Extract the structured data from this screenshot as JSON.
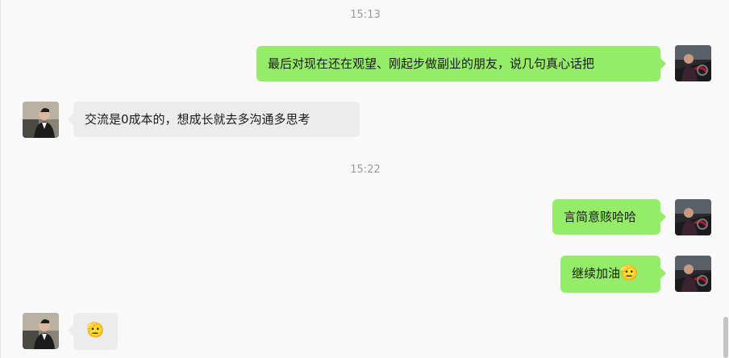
{
  "messages": {
    "time1": "15:13",
    "m1": "最后对现在还在观望、刚起步做副业的朋友，说几句真心话把",
    "m2": "交流是0成本的，想成长就去多沟通多思考",
    "time2": "15:22",
    "m3": "言简意赅哈哈",
    "m4_text": "继续加油",
    "m4_emoji": "🫡",
    "m5_emoji": "🫡"
  },
  "icons": {
    "self_avatar": "driver-avatar",
    "other_avatar": "person-avatar"
  },
  "colors": {
    "self_bubble": "#95ec69",
    "other_bubble": "#ececec",
    "background": "#f9f9f9"
  }
}
